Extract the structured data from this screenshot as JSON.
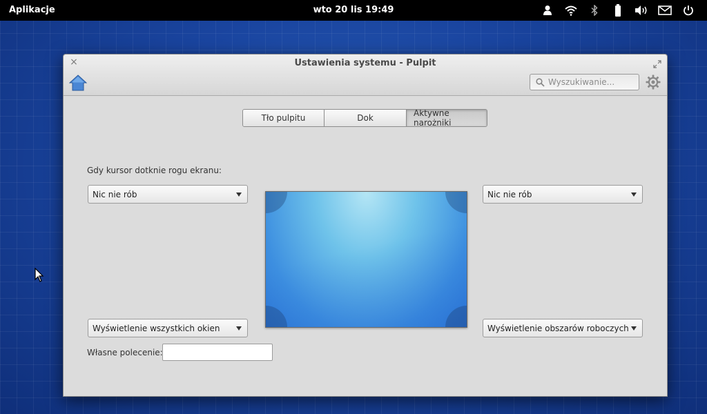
{
  "panel": {
    "apps_label": "Aplikacje",
    "clock": "wto 20 lis 19:49",
    "indicators": [
      "user-icon",
      "wifi-icon",
      "bluetooth-icon",
      "battery-icon",
      "volume-icon",
      "mail-icon",
      "power-icon"
    ]
  },
  "window": {
    "title": "Ustawienia systemu - Pulpit",
    "search_placeholder": "Wyszukiwanie...",
    "tabs": [
      {
        "label": "Tło pulpitu",
        "active": false
      },
      {
        "label": "Dok",
        "active": false
      },
      {
        "label": "Aktywne narożniki",
        "active": true
      }
    ],
    "instruction": "Gdy kursor dotknie rogu ekranu:",
    "corners": {
      "top_left": "Nic nie rób",
      "top_right": "Nic nie rób",
      "bottom_left": "Wyświetlenie wszystkich okien",
      "bottom_right": "Wyświetlenie obszarów roboczych"
    },
    "custom_command_label": "Własne polecenie:",
    "custom_command_value": ""
  },
  "colors": {
    "panel_bg": "#000000",
    "window_bg": "#dcdcdc",
    "desktop_bg": "#1a45a0"
  }
}
